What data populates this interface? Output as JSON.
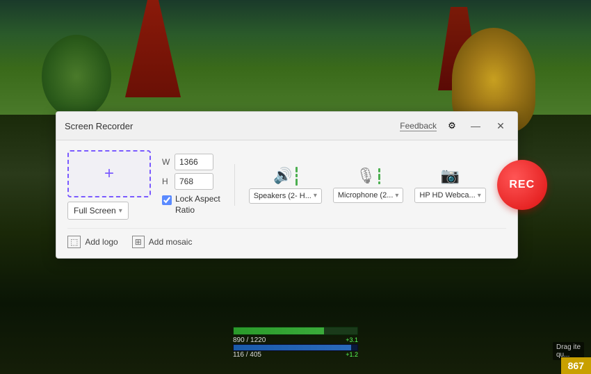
{
  "background": {
    "color_top": "#2a4a1a",
    "color_bottom": "#0a1505"
  },
  "dialog": {
    "title": "Screen Recorder",
    "feedback_label": "Feedback",
    "gear_icon": "⚙",
    "minimize_icon": "—",
    "close_icon": "✕"
  },
  "capture": {
    "plus_icon": "+",
    "w_label": "W",
    "h_label": "H",
    "w_value": "1366",
    "h_value": "768",
    "screen_mode": "Full Screen",
    "lock_aspect_label": "Lock Aspect\nRatio",
    "lock_checked": true
  },
  "audio": {
    "speakers_label": "Speakers (2- H...",
    "microphone_label": "Microphone (2...",
    "webcam_label": "HP HD Webca...",
    "speakers_icon": "🔊",
    "microphone_icon": "🎤",
    "webcam_icon": "📷"
  },
  "rec_button": {
    "label": "REC"
  },
  "addons": {
    "add_logo_icon": "⬜",
    "add_logo_label": "Add logo",
    "add_mosaic_icon": "⊞",
    "add_mosaic_label": "Add mosaic"
  },
  "hud": {
    "hp_text": "890 / 1220",
    "mp_text": "116 / 405",
    "hp_plus": "+3.1",
    "mp_plus": "+1.2",
    "gold": "867"
  }
}
